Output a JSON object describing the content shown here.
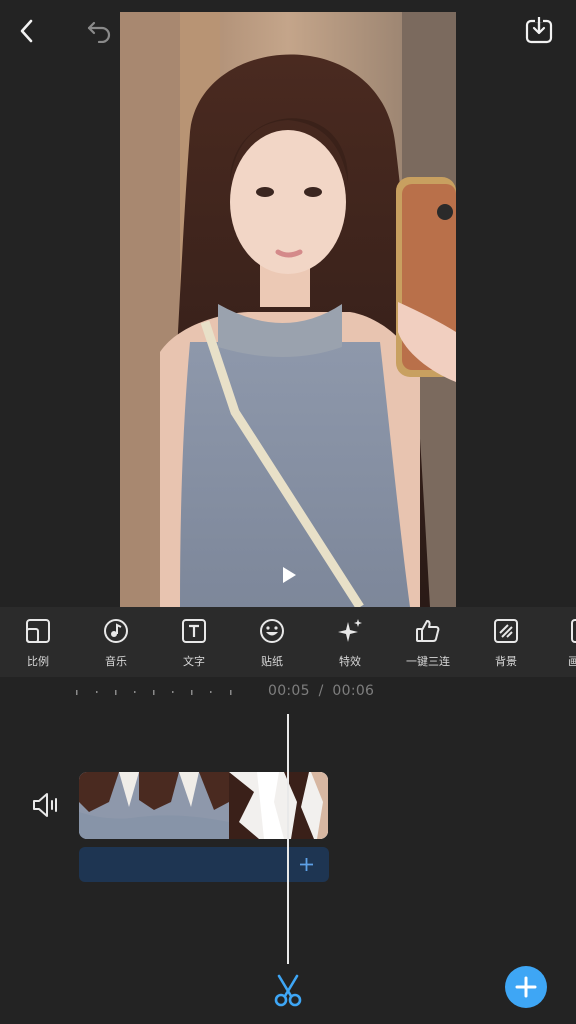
{
  "top_bar": {
    "back": "back-icon",
    "undo": "undo-icon",
    "redo": "redo-icon",
    "export": "download-icon"
  },
  "preview": {
    "state": "paused",
    "play_icon": "play-icon"
  },
  "toolbar": {
    "items": [
      {
        "label": "比例",
        "icon": "ratio-icon"
      },
      {
        "label": "音乐",
        "icon": "music-icon"
      },
      {
        "label": "文字",
        "icon": "text-icon"
      },
      {
        "label": "贴纸",
        "icon": "sticker-icon"
      },
      {
        "label": "特效",
        "icon": "sparkle-icon"
      },
      {
        "label": "一键三连",
        "icon": "thumbs-up-icon"
      },
      {
        "label": "背景",
        "icon": "background-icon"
      },
      {
        "label": "画",
        "icon": "canvas-icon"
      }
    ]
  },
  "timeline": {
    "current_time": "00:05",
    "separator": "/",
    "total_time": "00:06"
  },
  "track": {
    "audio_icon": "volume-icon",
    "add_track_icon": "plus-icon"
  },
  "bottom": {
    "cut_icon": "scissors-icon",
    "add_icon": "plus-icon"
  },
  "colors": {
    "background": "#232323",
    "toolbar": "#2b2b2b",
    "accent": "#3ea6f5",
    "track_add": "#1e3552"
  }
}
